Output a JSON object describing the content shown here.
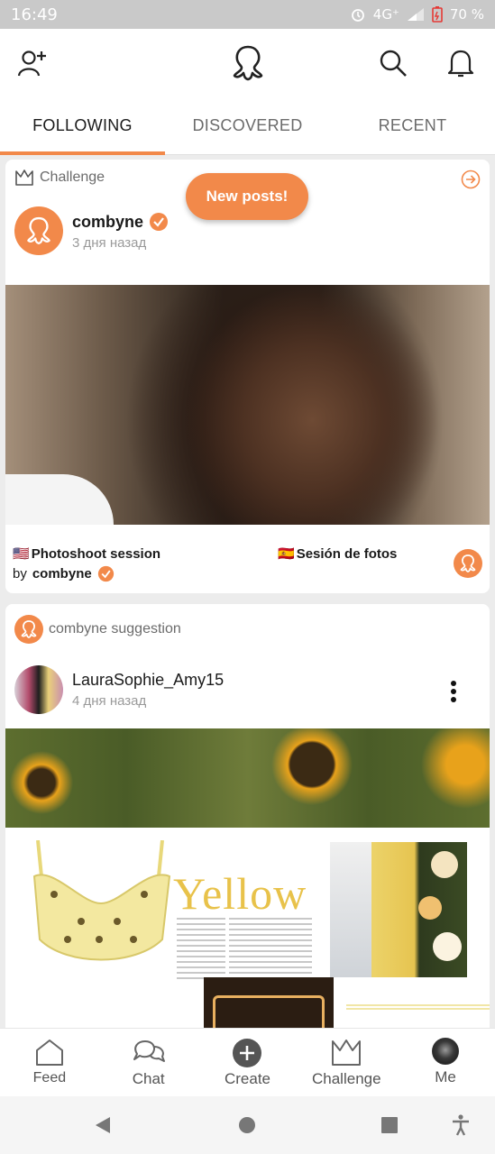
{
  "status_bar": {
    "time": "16:49",
    "network": "4G⁺",
    "battery": "70 %"
  },
  "header": {
    "add_friend_icon": "person-add-icon",
    "logo_icon": "octopus-logo-icon",
    "search_icon": "search-icon",
    "notifications_icon": "bell-icon"
  },
  "tabs": [
    {
      "label": "FOLLOWING"
    },
    {
      "label": "DISCOVERED"
    },
    {
      "label": "RECENT"
    }
  ],
  "new_posts_label": "New posts!",
  "post1": {
    "type_label": "Challenge",
    "user": "combyne",
    "time_ago": "3 дня назад",
    "caption_en_flag": "🇺🇸",
    "caption_en": "Photoshoot session",
    "caption_es_flag": "🇪🇸",
    "caption_es": "Sesión de fotos",
    "by_label": "by",
    "by_user": "combyne"
  },
  "post2": {
    "type_label": "combyne suggestion",
    "user": "LauraSophie_Amy15",
    "time_ago": "4 дня назад",
    "collage_title": "Yellow"
  },
  "bottom_nav": [
    {
      "label": "Feed",
      "icon": "home-icon"
    },
    {
      "label": "Chat",
      "icon": "chat-icon"
    },
    {
      "label": "Create",
      "icon": "plus-circle-icon"
    },
    {
      "label": "Challenge",
      "icon": "crown-icon"
    },
    {
      "label": "Me",
      "icon": "profile-avatar"
    }
  ],
  "colors": {
    "accent": "#f2894a",
    "verified": "#f2894a"
  }
}
